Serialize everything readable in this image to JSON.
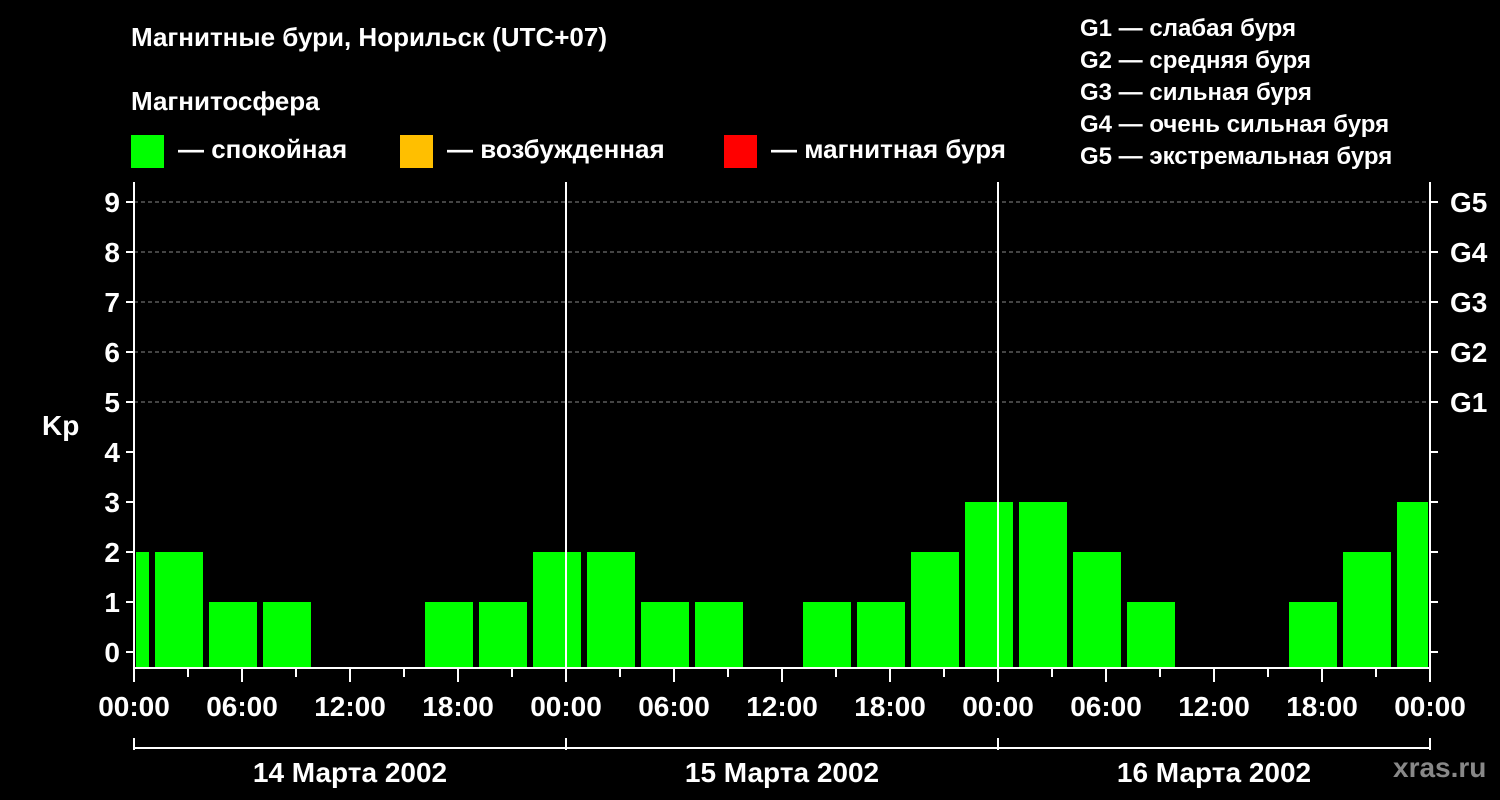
{
  "title": "Магнитные бури, Норильск (UTC+07)",
  "subtitle": "Магнитосфера",
  "legend": [
    {
      "color": "#00ff00",
      "label": "— спокойная"
    },
    {
      "color": "#ffbf00",
      "label": "— возбужденная"
    },
    {
      "color": "#ff0000",
      "label": "— магнитная буря"
    }
  ],
  "g_legend": [
    "G1 — слабая буря",
    "G2 — средняя буря",
    "G3 — сильная буря",
    "G4 — очень сильная буря",
    "G5 — экстремальная буря"
  ],
  "watermark": "xras.ru",
  "chart_data": {
    "type": "bar",
    "ylabel": "Kp",
    "ylim": [
      0,
      9
    ],
    "y_ticks": [
      "0",
      "1",
      "2",
      "3",
      "4",
      "5",
      "6",
      "7",
      "8",
      "9"
    ],
    "right_ticks": [
      {
        "value": 5,
        "label": "G1"
      },
      {
        "value": 6,
        "label": "G2"
      },
      {
        "value": 7,
        "label": "G3"
      },
      {
        "value": 8,
        "label": "G4"
      },
      {
        "value": 9,
        "label": "G5"
      }
    ],
    "x_tick_labels": [
      "00:00",
      "06:00",
      "12:00",
      "18:00",
      "00:00",
      "06:00",
      "12:00",
      "18:00",
      "00:00",
      "06:00",
      "12:00",
      "18:00",
      "00:00"
    ],
    "day_labels": [
      "14 Марта 2002",
      "15 Марта 2002",
      "16 Марта 2002"
    ],
    "grid": "horizontal dashed at Kp 5-9",
    "color": "#00ff00",
    "bars": [
      {
        "start_hour": 0,
        "end_hour": 1,
        "kp": 2
      },
      {
        "start_hour": 1,
        "end_hour": 4,
        "kp": 2
      },
      {
        "start_hour": 4,
        "end_hour": 7,
        "kp": 1
      },
      {
        "start_hour": 7,
        "end_hour": 10,
        "kp": 1
      },
      {
        "start_hour": 10,
        "end_hour": 13,
        "kp": 0
      },
      {
        "start_hour": 13,
        "end_hour": 16,
        "kp": 0
      },
      {
        "start_hour": 16,
        "end_hour": 19,
        "kp": 1
      },
      {
        "start_hour": 19,
        "end_hour": 22,
        "kp": 1
      },
      {
        "start_hour": 22,
        "end_hour": 25,
        "kp": 2
      },
      {
        "start_hour": 25,
        "end_hour": 28,
        "kp": 2
      },
      {
        "start_hour": 28,
        "end_hour": 31,
        "kp": 1
      },
      {
        "start_hour": 31,
        "end_hour": 34,
        "kp": 1
      },
      {
        "start_hour": 34,
        "end_hour": 37,
        "kp": 0
      },
      {
        "start_hour": 37,
        "end_hour": 40,
        "kp": 1
      },
      {
        "start_hour": 40,
        "end_hour": 43,
        "kp": 1
      },
      {
        "start_hour": 43,
        "end_hour": 46,
        "kp": 2
      },
      {
        "start_hour": 46,
        "end_hour": 49,
        "kp": 3
      },
      {
        "start_hour": 49,
        "end_hour": 52,
        "kp": 3
      },
      {
        "start_hour": 52,
        "end_hour": 55,
        "kp": 2
      },
      {
        "start_hour": 55,
        "end_hour": 58,
        "kp": 1
      },
      {
        "start_hour": 58,
        "end_hour": 61,
        "kp": 0
      },
      {
        "start_hour": 61,
        "end_hour": 64,
        "kp": 0
      },
      {
        "start_hour": 64,
        "end_hour": 67,
        "kp": 1
      },
      {
        "start_hour": 67,
        "end_hour": 70,
        "kp": 2
      },
      {
        "start_hour": 70,
        "end_hour": 72,
        "kp": 3
      }
    ]
  }
}
